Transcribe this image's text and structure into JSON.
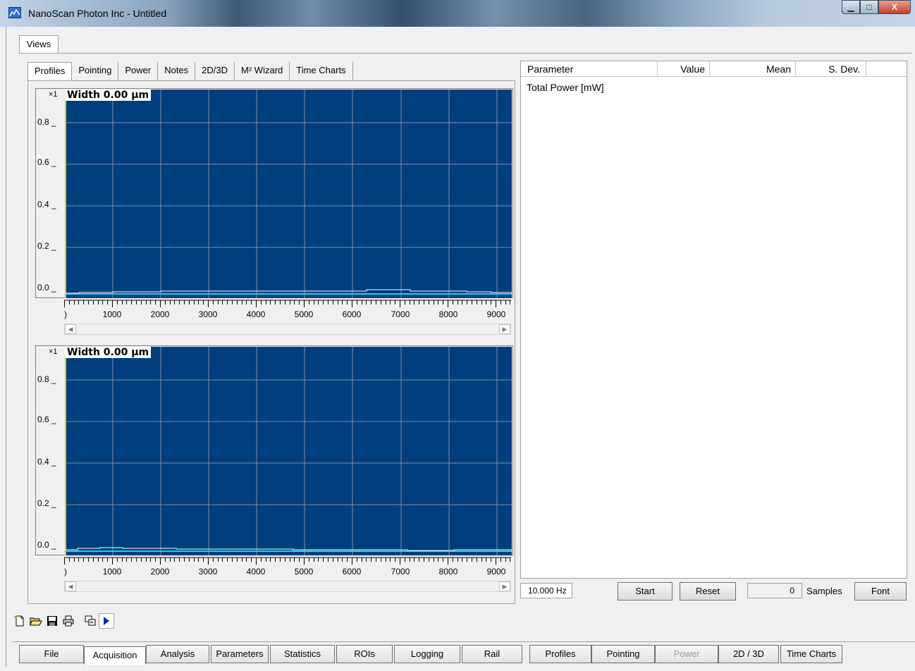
{
  "window": {
    "title": "NanoScan Photon Inc - Untitled",
    "minimize_glyph": "▁",
    "maximize_glyph": "□",
    "close_glyph": "X"
  },
  "views_tab": "Views",
  "subtabs": [
    "Profiles",
    "Pointing",
    "Power",
    "Notes",
    "2D/3D",
    "M² Wizard",
    "Time Charts"
  ],
  "profiles": [
    {
      "scale": "×1",
      "width_label": "Width 0.00 µm",
      "yticks": [
        "0.8 _",
        "0.6 _",
        "0.4 _",
        "0.2 _",
        "0.0 _"
      ],
      "xticks": [
        "1000",
        "2000",
        "3000",
        "4000",
        "5000",
        "6000",
        "7000",
        "8000",
        "9000"
      ],
      "x_zero": ")",
      "scroll_left": "◀",
      "scroll_right": "▶"
    },
    {
      "scale": "×1",
      "width_label": "Width 0.00 µm",
      "yticks": [
        "0.8 _",
        "0.6 _",
        "0.4 _",
        "0.2 _",
        "0.0 _"
      ],
      "xticks": [
        "1000",
        "2000",
        "3000",
        "4000",
        "5000",
        "6000",
        "7000",
        "8000",
        "9000"
      ],
      "x_zero": ")",
      "scroll_left": "◀",
      "scroll_right": "▶"
    }
  ],
  "results_grid": {
    "headers": {
      "param": "Parameter",
      "value": "Value",
      "mean": "Mean",
      "sdev": "S. Dev."
    },
    "rows": [
      {
        "param": "Total Power [mW]"
      }
    ]
  },
  "stats_bar": {
    "rate": "10.000 Hz",
    "start": "Start",
    "reset": "Reset",
    "samples_count": "0",
    "samples_label": "Samples",
    "font": "Font"
  },
  "bottom_tabs": [
    "File",
    "Acquisition",
    "Analysis",
    "Parameters",
    "Statistics",
    "ROIs",
    "Logging",
    "Rail"
  ],
  "bottom_view_tabs": [
    "Profiles",
    "Pointing",
    "Power",
    "2D / 3D",
    "Time Charts"
  ],
  "colors": {
    "plot_bg": "#003e7e",
    "grid": "#7f8fa8",
    "trace": "#ffffff",
    "trace2": "#1fd1e8",
    "cursor": "#e0d000"
  }
}
